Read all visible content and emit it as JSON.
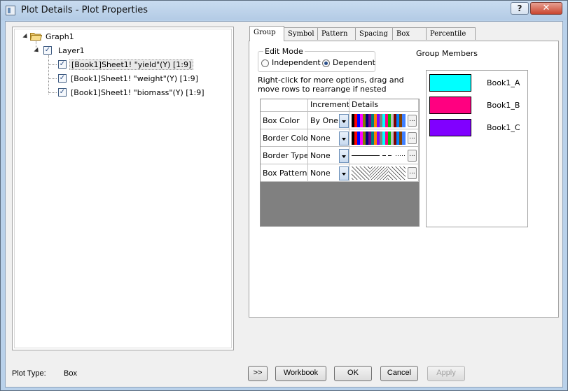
{
  "window": {
    "title": "Plot Details - Plot Properties",
    "help_label": "?",
    "close_label": "✕"
  },
  "tree": {
    "root": "Graph1",
    "layer": "Layer1",
    "plots": [
      "[Book1]Sheet1! \"yield\"(Y) [1:9]",
      "[Book1]Sheet1! \"weight\"(Y) [1:9]",
      "[Book1]Sheet1! \"biomass\"(Y) [1:9]"
    ]
  },
  "tabs": [
    "Group",
    "Symbol",
    "Pattern",
    "Spacing",
    "Box",
    "Percentile"
  ],
  "group": {
    "edit_mode_label": "Edit Mode",
    "independent_label": "Independent",
    "dependent_label": "Dependent",
    "selected_mode": "Dependent",
    "hint": "Right-click for more options, drag and move rows to  rearrange if nested",
    "columns": [
      "",
      "Increment",
      "Details"
    ],
    "rows": [
      {
        "name": "Box Color",
        "increment": "By One",
        "details": "color-list"
      },
      {
        "name": "Border Color",
        "increment": "None",
        "details": "color-list"
      },
      {
        "name": "Border Type",
        "increment": "None",
        "details": "line-style"
      },
      {
        "name": "Box Pattern",
        "increment": "None",
        "details": "pattern"
      }
    ],
    "more_label": "...",
    "members_title": "Group Members",
    "members": [
      {
        "name": "Book1_A",
        "color": "#00ffff"
      },
      {
        "name": "Book1_B",
        "color": "#ff0080"
      },
      {
        "name": "Book1_C",
        "color": "#8000ff"
      }
    ]
  },
  "footer": {
    "plot_type_label": "Plot Type:",
    "plot_type_value": "Box",
    "expand_label": ">>",
    "workbook_label": "Workbook",
    "ok_label": "OK",
    "cancel_label": "Cancel",
    "apply_label": "Apply"
  }
}
